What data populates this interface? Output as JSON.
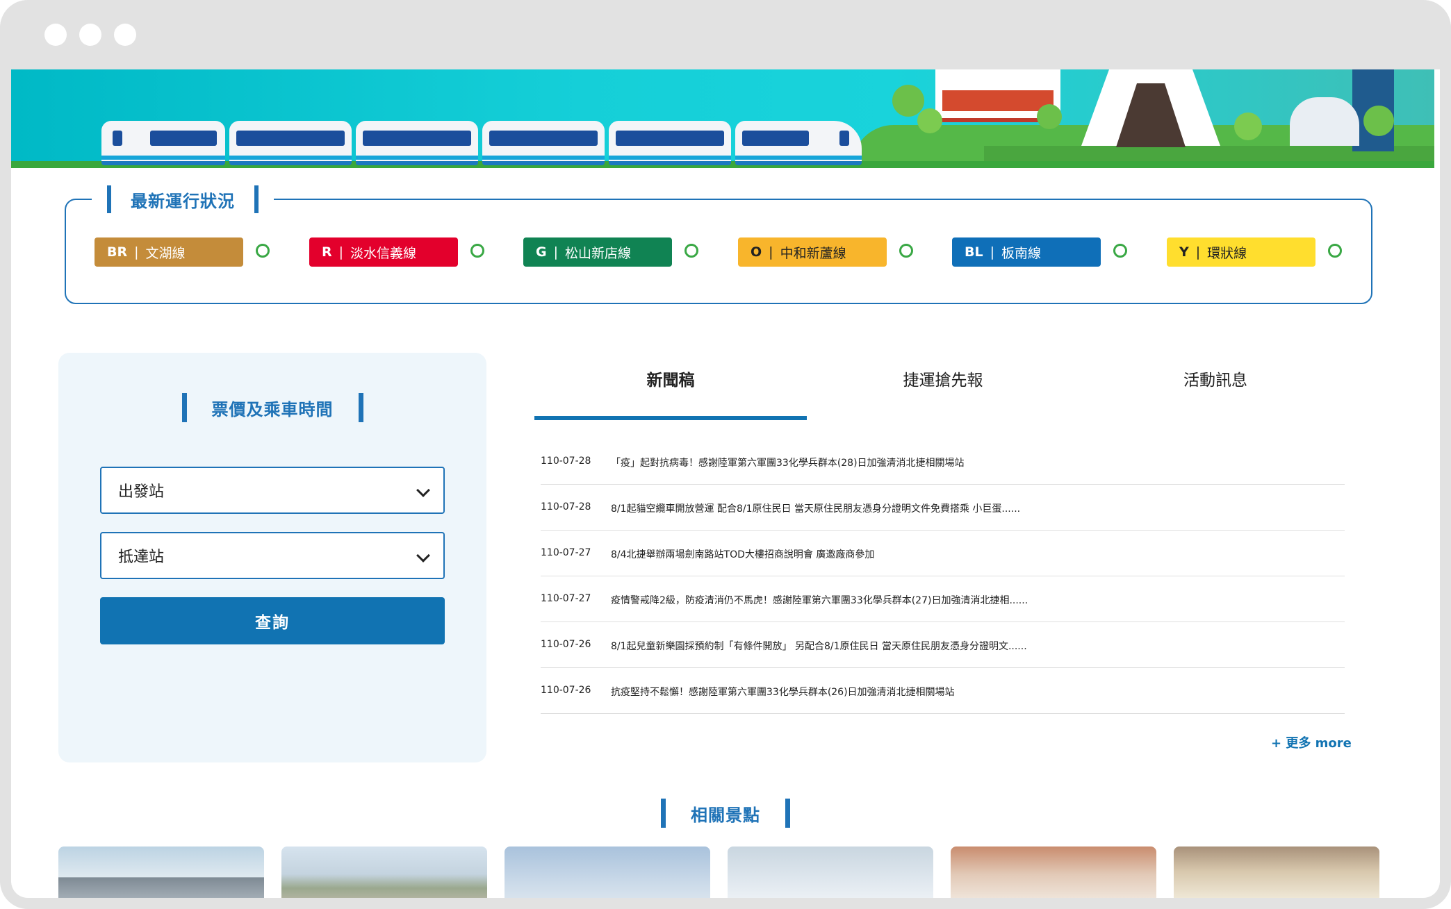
{
  "status": {
    "title": "最新運行狀況",
    "lines": [
      {
        "code": "BR",
        "name": "文湖線",
        "color": "#c48c3a",
        "text_color": "#ffffff"
      },
      {
        "code": "R",
        "name": "淡水信義線",
        "color": "#e3002c",
        "text_color": "#ffffff"
      },
      {
        "code": "G",
        "name": "松山新店線",
        "color": "#108353",
        "text_color": "#ffffff"
      },
      {
        "code": "O",
        "name": "中和新蘆線",
        "color": "#f8b52c",
        "text_color": "#222222"
      },
      {
        "code": "BL",
        "name": "板南線",
        "color": "#0f6fb8",
        "text_color": "#ffffff"
      },
      {
        "code": "Y",
        "name": "環狀線",
        "color": "#ffde2e",
        "text_color": "#222222"
      }
    ],
    "separator": "|",
    "indicator_color": "#3aa845"
  },
  "fare": {
    "title": "票價及乘車時間",
    "departure_placeholder": "出發站",
    "arrival_placeholder": "抵達站",
    "query_label": "查詢"
  },
  "news": {
    "tabs": [
      {
        "label": "新聞稿",
        "active": true
      },
      {
        "label": "捷運搶先報",
        "active": false
      },
      {
        "label": "活動訊息",
        "active": false
      }
    ],
    "items": [
      {
        "date": "110-07-28",
        "title": "「疫」起對抗病毒！感謝陸軍第六軍團33化學兵群本(28)日加強清消北捷相關場站"
      },
      {
        "date": "110-07-28",
        "title": "8/1起貓空纜車開放營運 配合8/1原住民日 當天原住民朋友憑身分證明文件免費搭乘 小巨蛋......"
      },
      {
        "date": "110-07-27",
        "title": "8/4北捷舉辦兩場劍南路站TOD大樓招商說明會 廣邀廠商參加"
      },
      {
        "date": "110-07-27",
        "title": "疫情警戒降2級，防疫清消仍不馬虎！感謝陸軍第六軍團33化學兵群本(27)日加強清消北捷相......"
      },
      {
        "date": "110-07-26",
        "title": "8/1起兒童新樂園採預約制「有條件開放」 另配合8/1原住民日  當天原住民朋友憑身分證明文......"
      },
      {
        "date": "110-07-26",
        "title": "抗疫堅持不鬆懈！感謝陸軍第六軍團33化學兵群本(26)日加強清消北捷相關場站"
      }
    ],
    "more_label": "+ 更多 more"
  },
  "attractions": {
    "title": "相關景點"
  },
  "accent_color": "#1173b2"
}
